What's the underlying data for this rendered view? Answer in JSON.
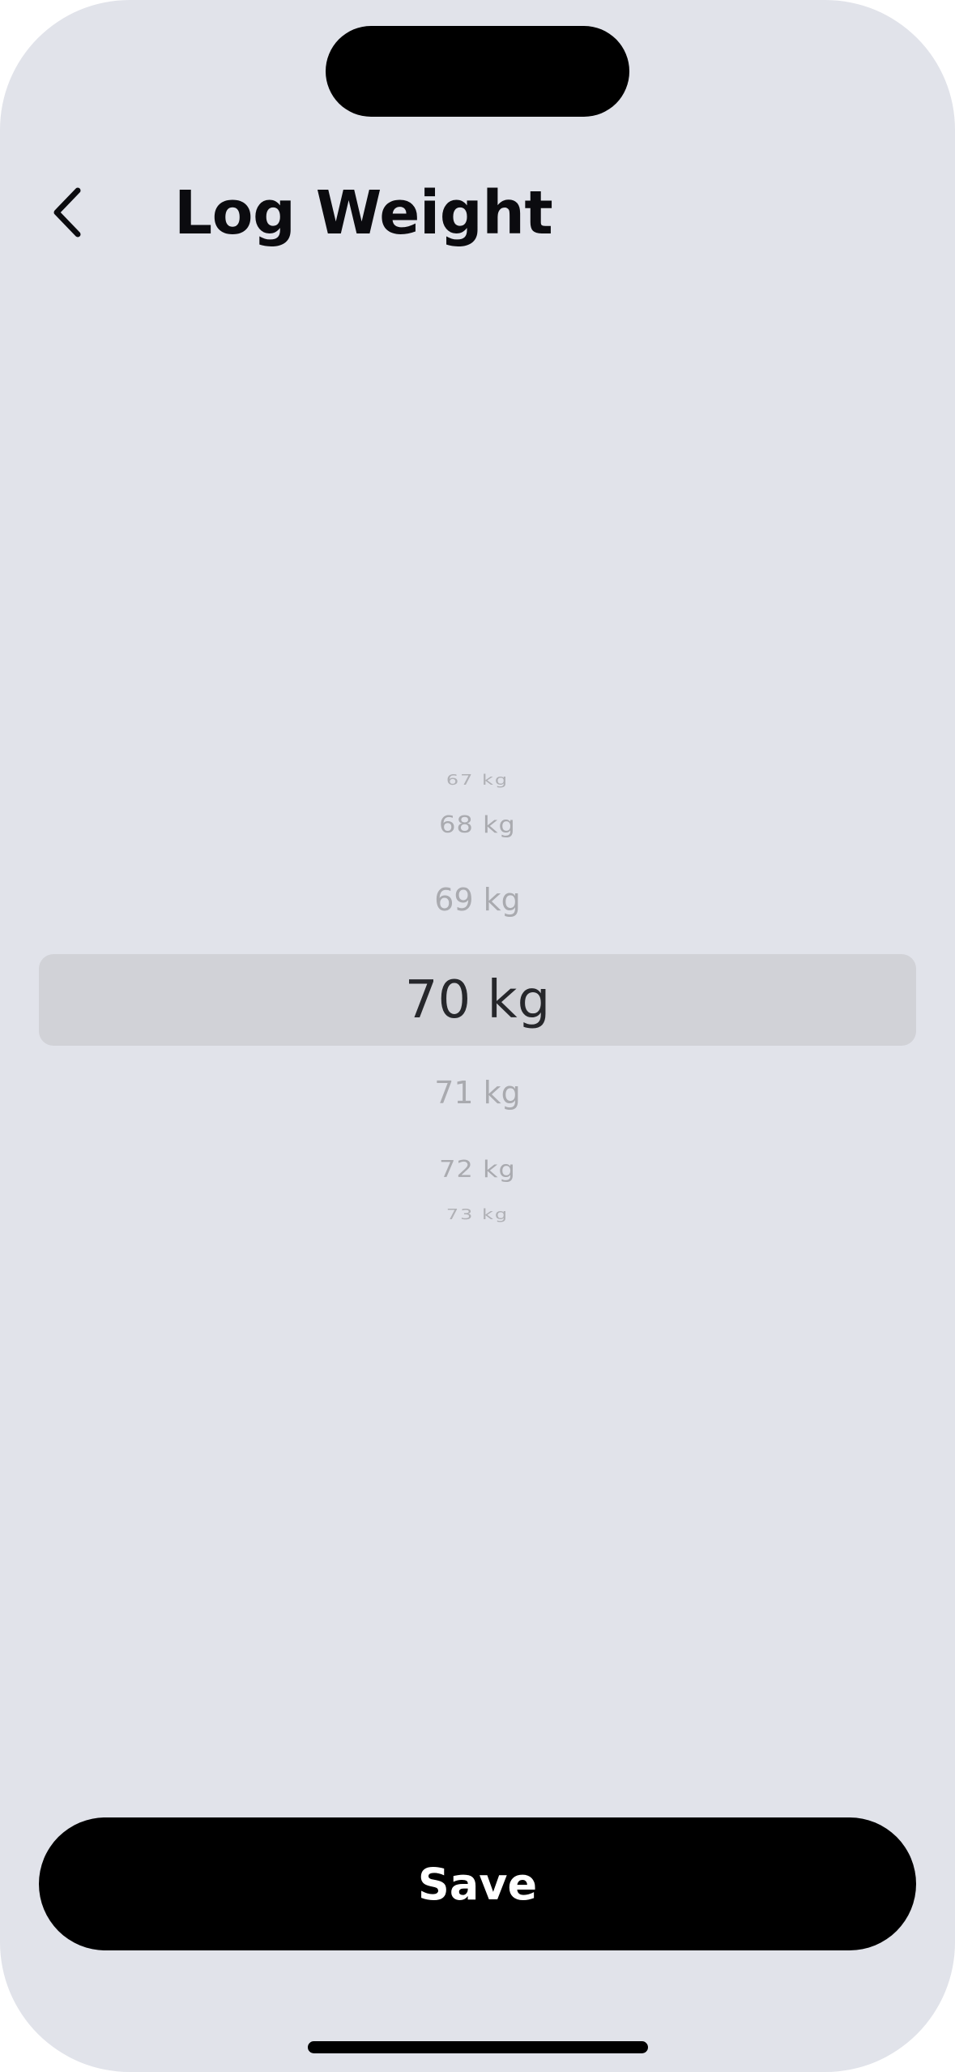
{
  "header": {
    "title": "Log Weight",
    "back_icon": "chevron-left-icon"
  },
  "picker": {
    "unit": "kg",
    "selected_value": 70,
    "items": {
      "above_3": "67 kg",
      "above_2": "68 kg",
      "above_1": "69 kg",
      "selected": "70 kg",
      "below_1": "71 kg",
      "below_2": "72 kg",
      "below_3": "73 kg"
    }
  },
  "footer": {
    "save_label": "Save"
  },
  "colors": {
    "background": "#e1e3ea",
    "highlight": "#d1d2d7",
    "button": "#000000",
    "button_text": "#ffffff",
    "muted_text": "#a9aaaf"
  }
}
